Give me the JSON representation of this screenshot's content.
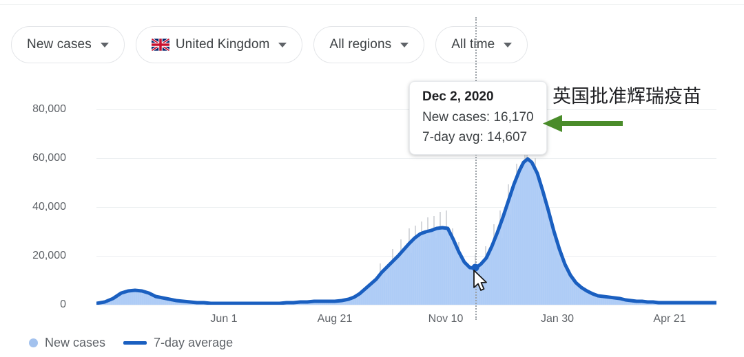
{
  "filters": [
    {
      "label": "New cases",
      "icon": "chevron-down-icon",
      "flag": false
    },
    {
      "label": "United Kingdom",
      "icon": "chevron-down-icon",
      "flag": true,
      "flag_name": "united-kingdom-flag-icon"
    },
    {
      "label": "All regions",
      "icon": "chevron-down-icon",
      "flag": false
    },
    {
      "label": "All time",
      "icon": "chevron-down-icon",
      "flag": false
    }
  ],
  "tooltip": {
    "date": "Dec 2, 2020",
    "new_cases": "New cases: 16,170",
    "seven_day_avg": "7-day avg: 14,607"
  },
  "annotation": {
    "text": "英国批准辉瑞疫苗",
    "arrow_color": "#4a8c2a",
    "arrow_direction": "left"
  },
  "legend": [
    {
      "label": "New cases",
      "marker": "dot",
      "color": "#a3c2ee"
    },
    {
      "label": "7-day average",
      "marker": "line",
      "color": "#1a5fc0"
    }
  ],
  "colors": {
    "bars": "#aecbf5",
    "line": "#1a5fc0",
    "grid": "#eceff1",
    "axis_text": "#5f6368",
    "annotation_green": "#4a8c2a"
  },
  "chart_data": {
    "type": "area",
    "title": "",
    "xlabel": "",
    "ylabel": "",
    "grid": true,
    "legend_position": "bottom-left",
    "ylim": [
      0,
      88000
    ],
    "yticks": [
      0,
      20000,
      40000,
      60000,
      80000
    ],
    "ytick_labels": [
      "0",
      "20,000",
      "40,000",
      "60,000",
      "80,000"
    ],
    "xticks": [
      "Jun 1",
      "Aug 21",
      "Nov 10",
      "Jan 30",
      "Apr 21"
    ],
    "xlim": [
      "Feb 2020",
      "May 2021"
    ],
    "highlight": {
      "x": "Dec 2, 2020",
      "new_cases": 16170,
      "seven_day_avg": 14607
    },
    "series": [
      {
        "name": "7-day average",
        "type": "line",
        "color": "#1a5fc0",
        "x": [
          "Mar 1",
          "Mar 15",
          "Apr 1",
          "Apr 12",
          "Apr 25",
          "May 10",
          "May 25",
          "Jun 1",
          "Jun 15",
          "Jul 1",
          "Jul 15",
          "Aug 1",
          "Aug 21",
          "Sep 1",
          "Sep 15",
          "Sep 25",
          "Oct 5",
          "Oct 12",
          "Oct 20",
          "Oct 28",
          "Nov 3",
          "Nov 10",
          "Nov 16",
          "Nov 24",
          "Dec 2",
          "Dec 10",
          "Dec 18",
          "Dec 26",
          "Jan 2",
          "Jan 8",
          "Jan 12",
          "Jan 20",
          "Jan 30",
          "Feb 8",
          "Feb 18",
          "Mar 1",
          "Mar 12",
          "Mar 25",
          "Apr 8",
          "Apr 21",
          "May 1"
        ],
        "values": [
          500,
          2500,
          4800,
          5200,
          4600,
          3400,
          2400,
          1800,
          1300,
          700,
          650,
          900,
          1100,
          1300,
          3000,
          5500,
          10500,
          15500,
          19500,
          22500,
          24500,
          25500,
          22000,
          17500,
          14607,
          20500,
          30000,
          42000,
          55000,
          59500,
          60000,
          45000,
          30000,
          18000,
          12000,
          8000,
          6000,
          5500,
          2800,
          2300,
          2100
        ]
      },
      {
        "name": "New cases",
        "type": "bar",
        "color": "#aecbf5",
        "note": "daily reported cases; bars fluctuate around the 7-day average with weekday spikes up to ~68,000 in early January"
      }
    ]
  }
}
